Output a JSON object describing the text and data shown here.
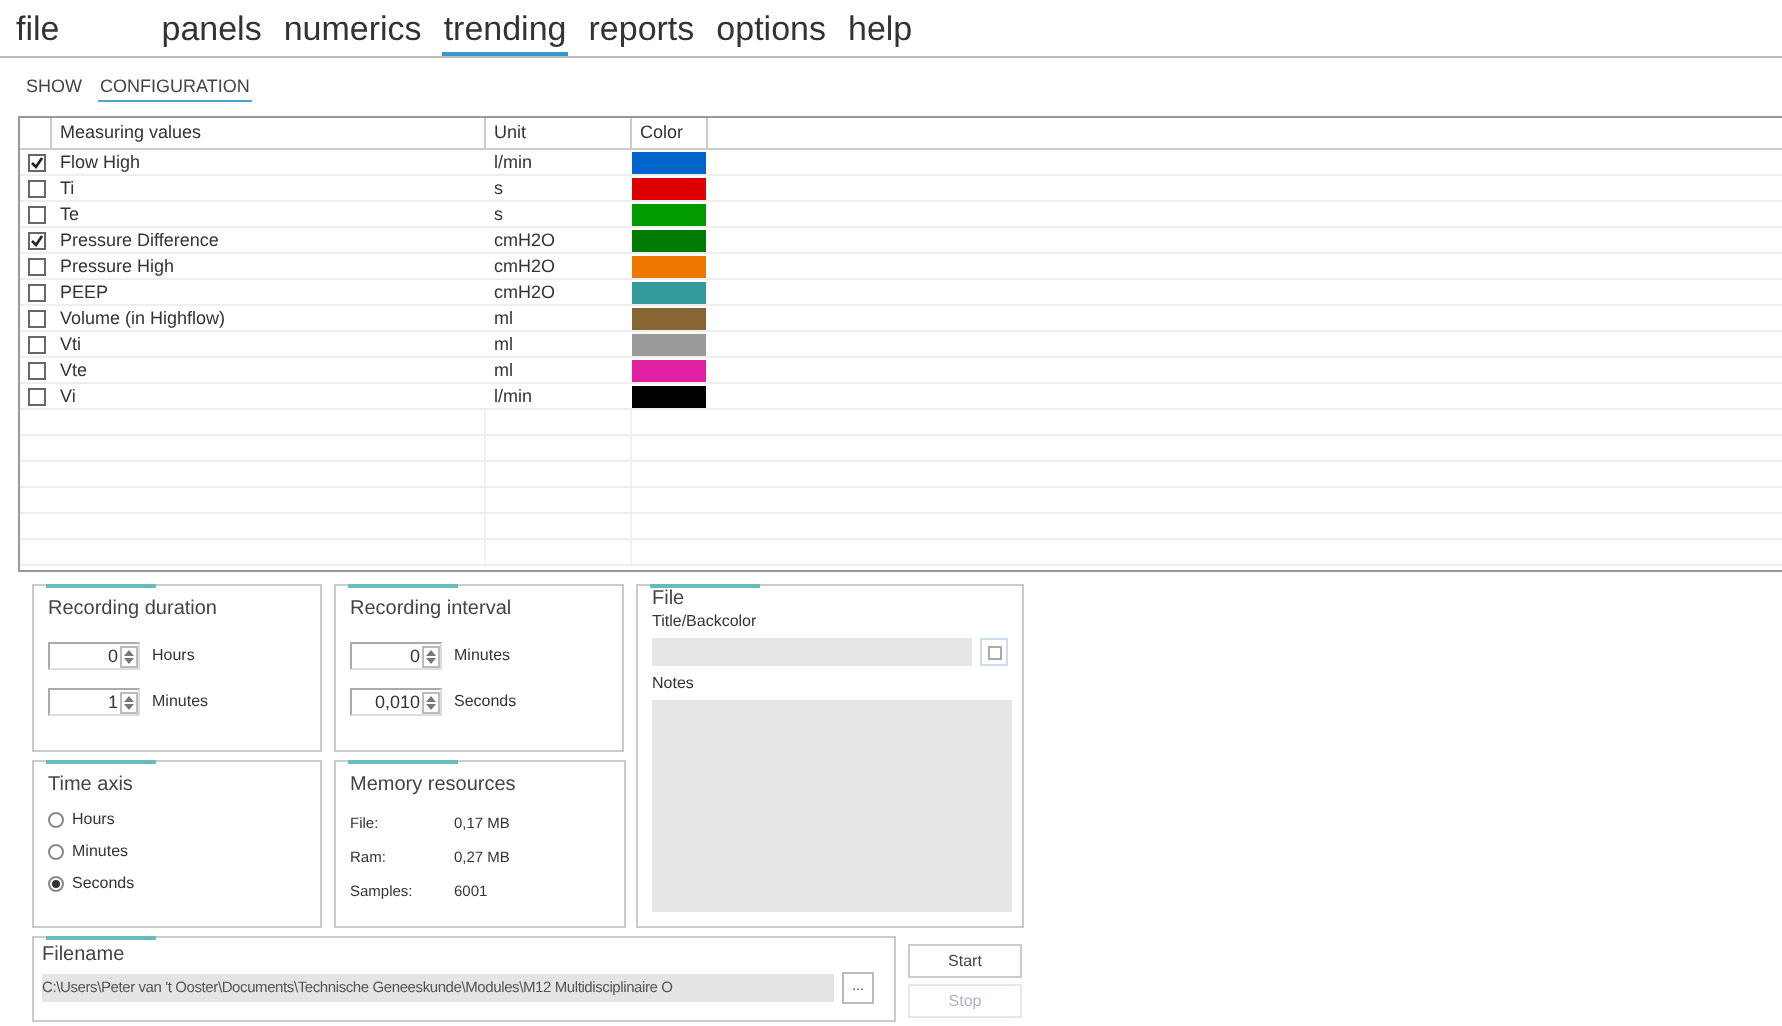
{
  "menu": [
    {
      "label": "file",
      "selected": false
    },
    {
      "label": "panels",
      "selected": false
    },
    {
      "label": "numerics",
      "selected": false
    },
    {
      "label": "trending",
      "selected": true
    },
    {
      "label": "reports",
      "selected": false
    },
    {
      "label": "options",
      "selected": false
    },
    {
      "label": "help",
      "selected": false
    }
  ],
  "subtabs": [
    {
      "label": "SHOW",
      "selected": false
    },
    {
      "label": "CONFIGURATION",
      "selected": true
    }
  ],
  "table": {
    "columns": [
      "Measuring values",
      "Unit",
      "Color"
    ],
    "rows": [
      {
        "checked": true,
        "name": "Flow High",
        "unit": "l/min",
        "color": "#0066cc"
      },
      {
        "checked": false,
        "name": "Ti",
        "unit": "s",
        "color": "#dd0000"
      },
      {
        "checked": false,
        "name": "Te",
        "unit": "s",
        "color": "#009900"
      },
      {
        "checked": true,
        "name": "Pressure Difference",
        "unit": "cmH2O",
        "color": "#007a00"
      },
      {
        "checked": false,
        "name": "Pressure High",
        "unit": "cmH2O",
        "color": "#ee7700"
      },
      {
        "checked": false,
        "name": "PEEP",
        "unit": "cmH2O",
        "color": "#339999"
      },
      {
        "checked": false,
        "name": "Volume (in Highflow)",
        "unit": "ml",
        "color": "#886633"
      },
      {
        "checked": false,
        "name": "Vti",
        "unit": "ml",
        "color": "#999999"
      },
      {
        "checked": false,
        "name": "Vte",
        "unit": "ml",
        "color": "#e020a0"
      },
      {
        "checked": false,
        "name": "Vi",
        "unit": "l/min",
        "color": "#000000"
      }
    ]
  },
  "recording_duration": {
    "title": "Recording duration",
    "fields": [
      {
        "value": "0",
        "label": "Hours"
      },
      {
        "value": "1",
        "label": "Minutes"
      }
    ]
  },
  "recording_interval": {
    "title": "Recording interval",
    "fields": [
      {
        "value": "0",
        "label": "Minutes"
      },
      {
        "value": "0,010",
        "label": "Seconds"
      }
    ]
  },
  "file_group": {
    "title": "File",
    "title_label": "Title/Backcolor",
    "notes_label": "Notes"
  },
  "time_axis": {
    "title": "Time axis",
    "options": [
      {
        "label": "Hours",
        "selected": false
      },
      {
        "label": "Minutes",
        "selected": false
      },
      {
        "label": "Seconds",
        "selected": true
      }
    ]
  },
  "memory_resources": {
    "title": "Memory resources",
    "rows": [
      {
        "label": "File:",
        "value": "0,17 MB"
      },
      {
        "label": "Ram:",
        "value": "0,27 MB"
      },
      {
        "label": "Samples:",
        "value": "6001"
      }
    ]
  },
  "filename": {
    "title": "Filename",
    "value": "C:\\Users\\Peter van 't Ooster\\Documents\\Technische Geneeskunde\\Modules\\M12 Multidisciplinaire O",
    "browse_label": "..."
  },
  "buttons": [
    {
      "label": "Start",
      "disabled": false
    },
    {
      "label": "Stop",
      "disabled": true
    }
  ]
}
